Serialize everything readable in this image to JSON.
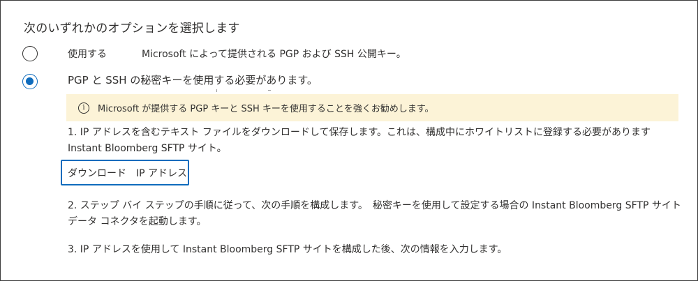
{
  "heading": "次のいずれかのオプションを選択します",
  "options": [
    {
      "label_a": "使用する",
      "label_b": "Microsoft によって提供される PGP および SSH 公開キー。",
      "selected": false
    },
    {
      "label": "PGP と SSH の秘密キーを使用する必要があります。",
      "selected": true
    }
  ],
  "banner": {
    "icon": "info-icon",
    "text": "Microsoft が提供する PGP キーと SSH キーを使用することを強くお勧めします。",
    "background": "#fcf3d7"
  },
  "steps": {
    "step1_line1": "1. IP アドレスを含むテキスト ファイルをダウンロードして保存します。これは、構成中にホワイトリストに登録する必要があります",
    "step1_line2": "Instant Bloomberg SFTP サイト。",
    "download_button": "ダウンロード　IP アドレス",
    "step2_line1": "2. ステップ バイ ステップの手順に従って、次の手順を構成します。　秘密キーを使用して設定する場合の Instant Bloomberg SFTP サイト",
    "step2_line2": "データ コネクタを起動します。",
    "step3": "3. IP アドレスを使用して Instant Bloomberg SFTP サイトを構成した後、次の情報を入力します。"
  },
  "colors": {
    "accent": "#0f6cbd",
    "text": "#323130"
  }
}
